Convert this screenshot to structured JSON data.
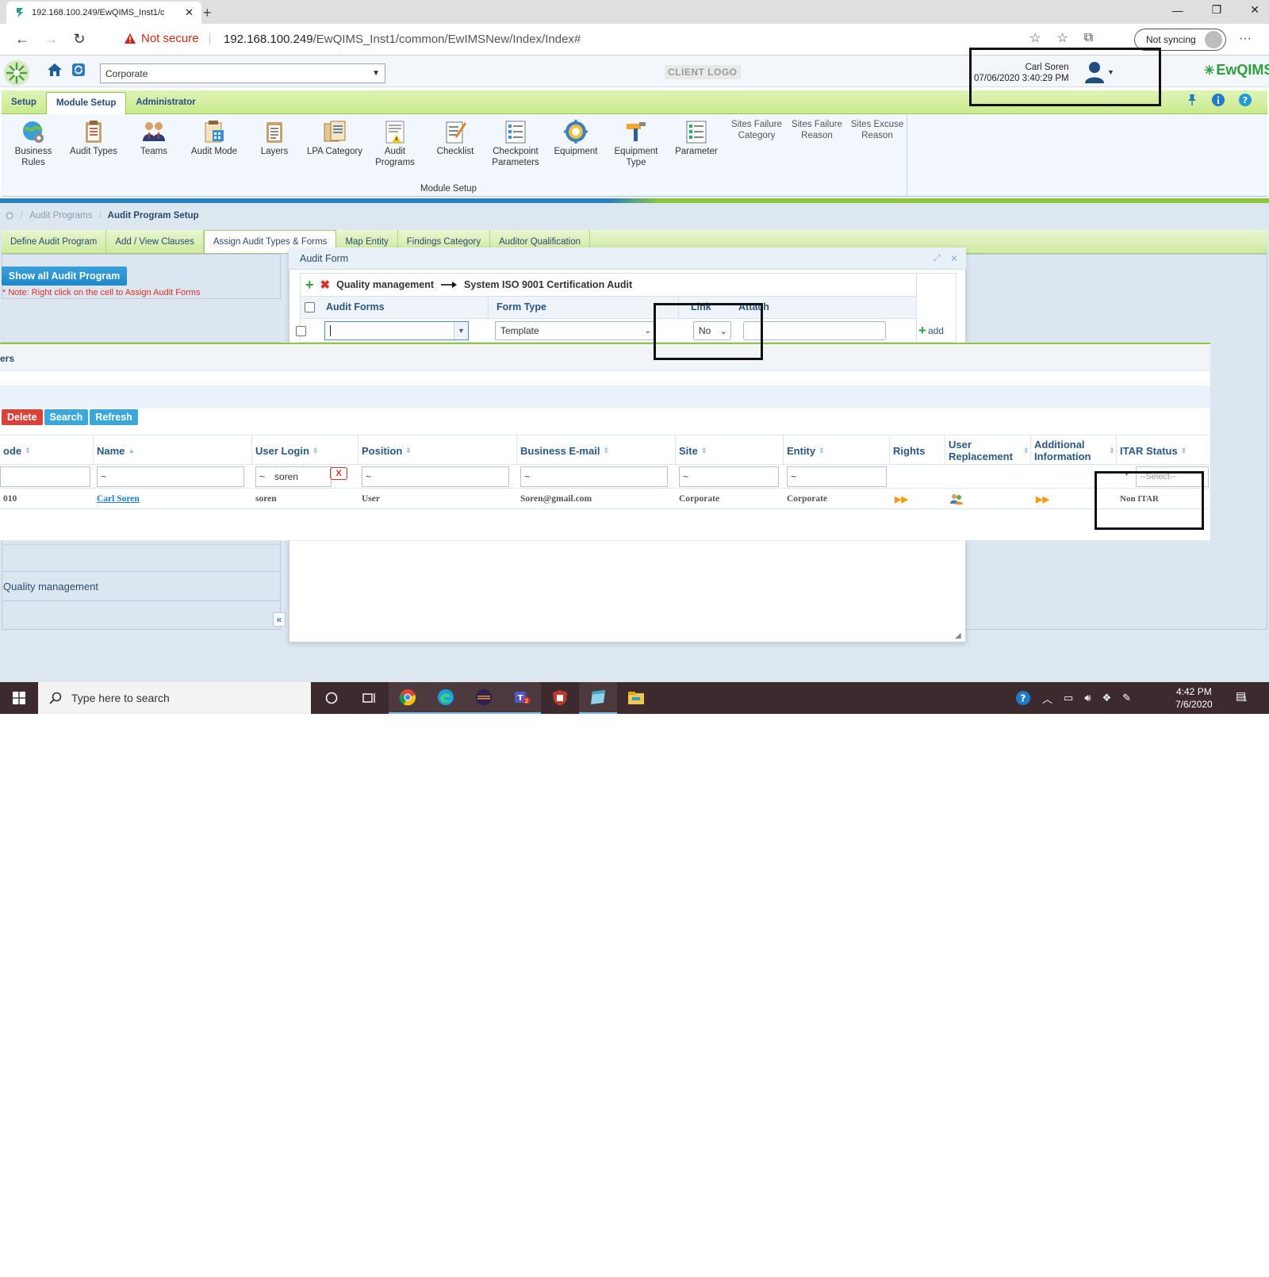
{
  "browser": {
    "tab_title": "192.168.100.249/EwQIMS_Inst1/c",
    "new_tab": "+",
    "security_label": "Not secure",
    "url_host": "192.168.100.249",
    "url_path": "/EwQIMS_Inst1/common/EwIMSNew/Index/Index#",
    "sync_label": "Not syncing",
    "more": "···"
  },
  "header": {
    "corporate_select": "Corporate",
    "client_logo": "CLIENT LOGO",
    "user_name": "Carl Soren",
    "datetime": "07/06/2020 3:40:29 PM",
    "brand": "EwQIMS"
  },
  "ribbon": {
    "tabs": [
      "Setup",
      "Module Setup",
      "Administrator"
    ],
    "active_tab": "Module Setup",
    "items": [
      {
        "label": "Business Rules",
        "icon": "globe-gear-icon"
      },
      {
        "label": "Audit Types",
        "icon": "clipboard-icon"
      },
      {
        "label": "Teams",
        "icon": "team-icon"
      },
      {
        "label": "Audit Mode",
        "icon": "calendar-doc-icon"
      },
      {
        "label": "Layers",
        "icon": "layers-icon"
      },
      {
        "label": "LPA Category",
        "icon": "category-icon"
      },
      {
        "label": "Audit Programs",
        "icon": "program-icon"
      },
      {
        "label": "Checklist",
        "icon": "checklist-icon"
      },
      {
        "label": "Checkpoint Parameters",
        "icon": "checkpoint-icon"
      },
      {
        "label": "Equipment",
        "icon": "gear-icon"
      },
      {
        "label": "Equipment Type",
        "icon": "tool-icon"
      },
      {
        "label": "Parameter",
        "icon": "parameter-icon"
      },
      {
        "label": "Sites Failure Category",
        "icon": "broken-image-icon"
      },
      {
        "label": "Sites Failure Reason",
        "icon": "broken-image-icon"
      },
      {
        "label": "Sites Excuse Reason",
        "icon": "broken-image-icon"
      }
    ],
    "group_caption": "Module Setup"
  },
  "breadcrumb": {
    "parent": "Audit Programs",
    "current": "Audit Program Setup"
  },
  "subtabs": [
    "Define Audit Program",
    "Add / View Clauses",
    "Assign Audit Types & Forms",
    "Map Entity",
    "Findings Category",
    "Auditor Qualification"
  ],
  "left_panel": {
    "show_all_button": "Show all Audit Program",
    "note": "* Note: Right click on the cell to Assign Audit Forms",
    "program_row": "Quality management",
    "collapse": "«"
  },
  "dialog": {
    "title": "Audit Form",
    "path_from": "Quality management",
    "path_to": "System ISO 9001 Certification Audit",
    "columns": [
      "Audit Forms",
      "Form Type",
      "Link",
      "Attach"
    ],
    "form_type_value": "Template",
    "link_value": "No",
    "add_label": "add"
  },
  "users_grid": {
    "title_fragment": "ers",
    "actions": [
      "Delete",
      "Search",
      "Refresh"
    ],
    "columns": [
      "ode",
      "Name",
      "User Login",
      "Position",
      "Business E-mail",
      "Site",
      "Entity",
      "Rights",
      "User Replacement",
      "Additional Information",
      "ITAR Status"
    ],
    "filters": {
      "tilde": "~",
      "user_login": "soren",
      "clear": "X",
      "itar_select": "--Select--"
    },
    "row": {
      "code": "010",
      "name": "Carl Soren",
      "user_login": "soren",
      "position": "User",
      "email": "Soren@gmail.com",
      "site": "Corporate",
      "entity": "Corporate",
      "rights": "▶▶",
      "additional": "▶▶",
      "itar_status": "Non ITAR"
    }
  },
  "taskbar": {
    "search_placeholder": "Type here to search",
    "time": "4:42 PM",
    "date": "7/6/2020",
    "notification_count": "1"
  },
  "colors": {
    "ribbon_green": "#c9ea8c",
    "link_blue": "#1b7fd1",
    "delete_red": "#d9413a",
    "button_blue": "#3ba8d9",
    "taskbar": "#3d2a2e"
  }
}
